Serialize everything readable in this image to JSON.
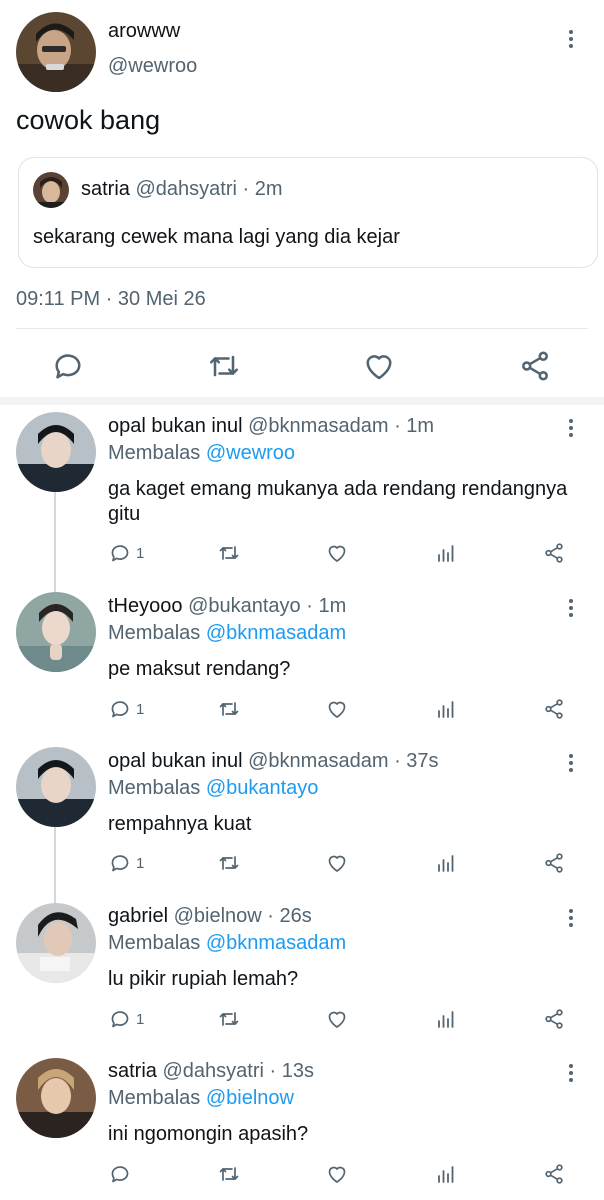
{
  "main_tweet": {
    "display_name": "arowww",
    "handle": "@wewroo",
    "text": "cowok bang",
    "timestamp": "09:11 PM · 30 Mei 26",
    "quoted": {
      "display_name": "satria",
      "handle": "@dahsyatri",
      "separator": "·",
      "time": "2m",
      "text": "sekarang cewek mana lagi yang dia kejar"
    }
  },
  "reply_prefix": "Membalas",
  "replies": [
    {
      "display_name": "opal bukan inul",
      "handle": "@bknmasadam",
      "separator": "·",
      "time": "1m",
      "replying_to": "@wewroo",
      "text": "ga kaget emang mukanya ada rendang rendangnya gitu",
      "reply_count": "1",
      "avatar_color": "#2f3a44"
    },
    {
      "display_name": "tHeyooo",
      "handle": "@bukantayo",
      "separator": "·",
      "time": "1m",
      "replying_to": "@bknmasadam",
      "text": "pe maksut rendang?",
      "reply_count": "1",
      "avatar_color": "#8fa6a3"
    },
    {
      "display_name": "opal bukan inul",
      "handle": "@bknmasadam",
      "separator": "·",
      "time": "37s",
      "replying_to": "@bukantayo",
      "text": "rempahnya kuat",
      "reply_count": "1",
      "avatar_color": "#2f3a44"
    },
    {
      "display_name": "gabriel",
      "handle": "@bielnow",
      "separator": "·",
      "time": "26s",
      "replying_to": "@bknmasadam",
      "text": "lu pikir rupiah lemah?",
      "reply_count": "1",
      "avatar_color": "#b9bcc0"
    },
    {
      "display_name": "satria",
      "handle": "@dahsyatri",
      "separator": "·",
      "time": "13s",
      "replying_to": "@bielnow",
      "text": "ini ngomongin apasih?",
      "reply_count": "",
      "avatar_color": "#7a5c45"
    }
  ],
  "colors": {
    "text": "#0f1419",
    "secondary": "#536471",
    "accent": "#1d9bf0",
    "divider": "#e7eaed"
  },
  "icons": [
    "more-vertical-icon",
    "reply-icon",
    "retweet-icon",
    "like-icon",
    "views-icon",
    "share-icon"
  ]
}
